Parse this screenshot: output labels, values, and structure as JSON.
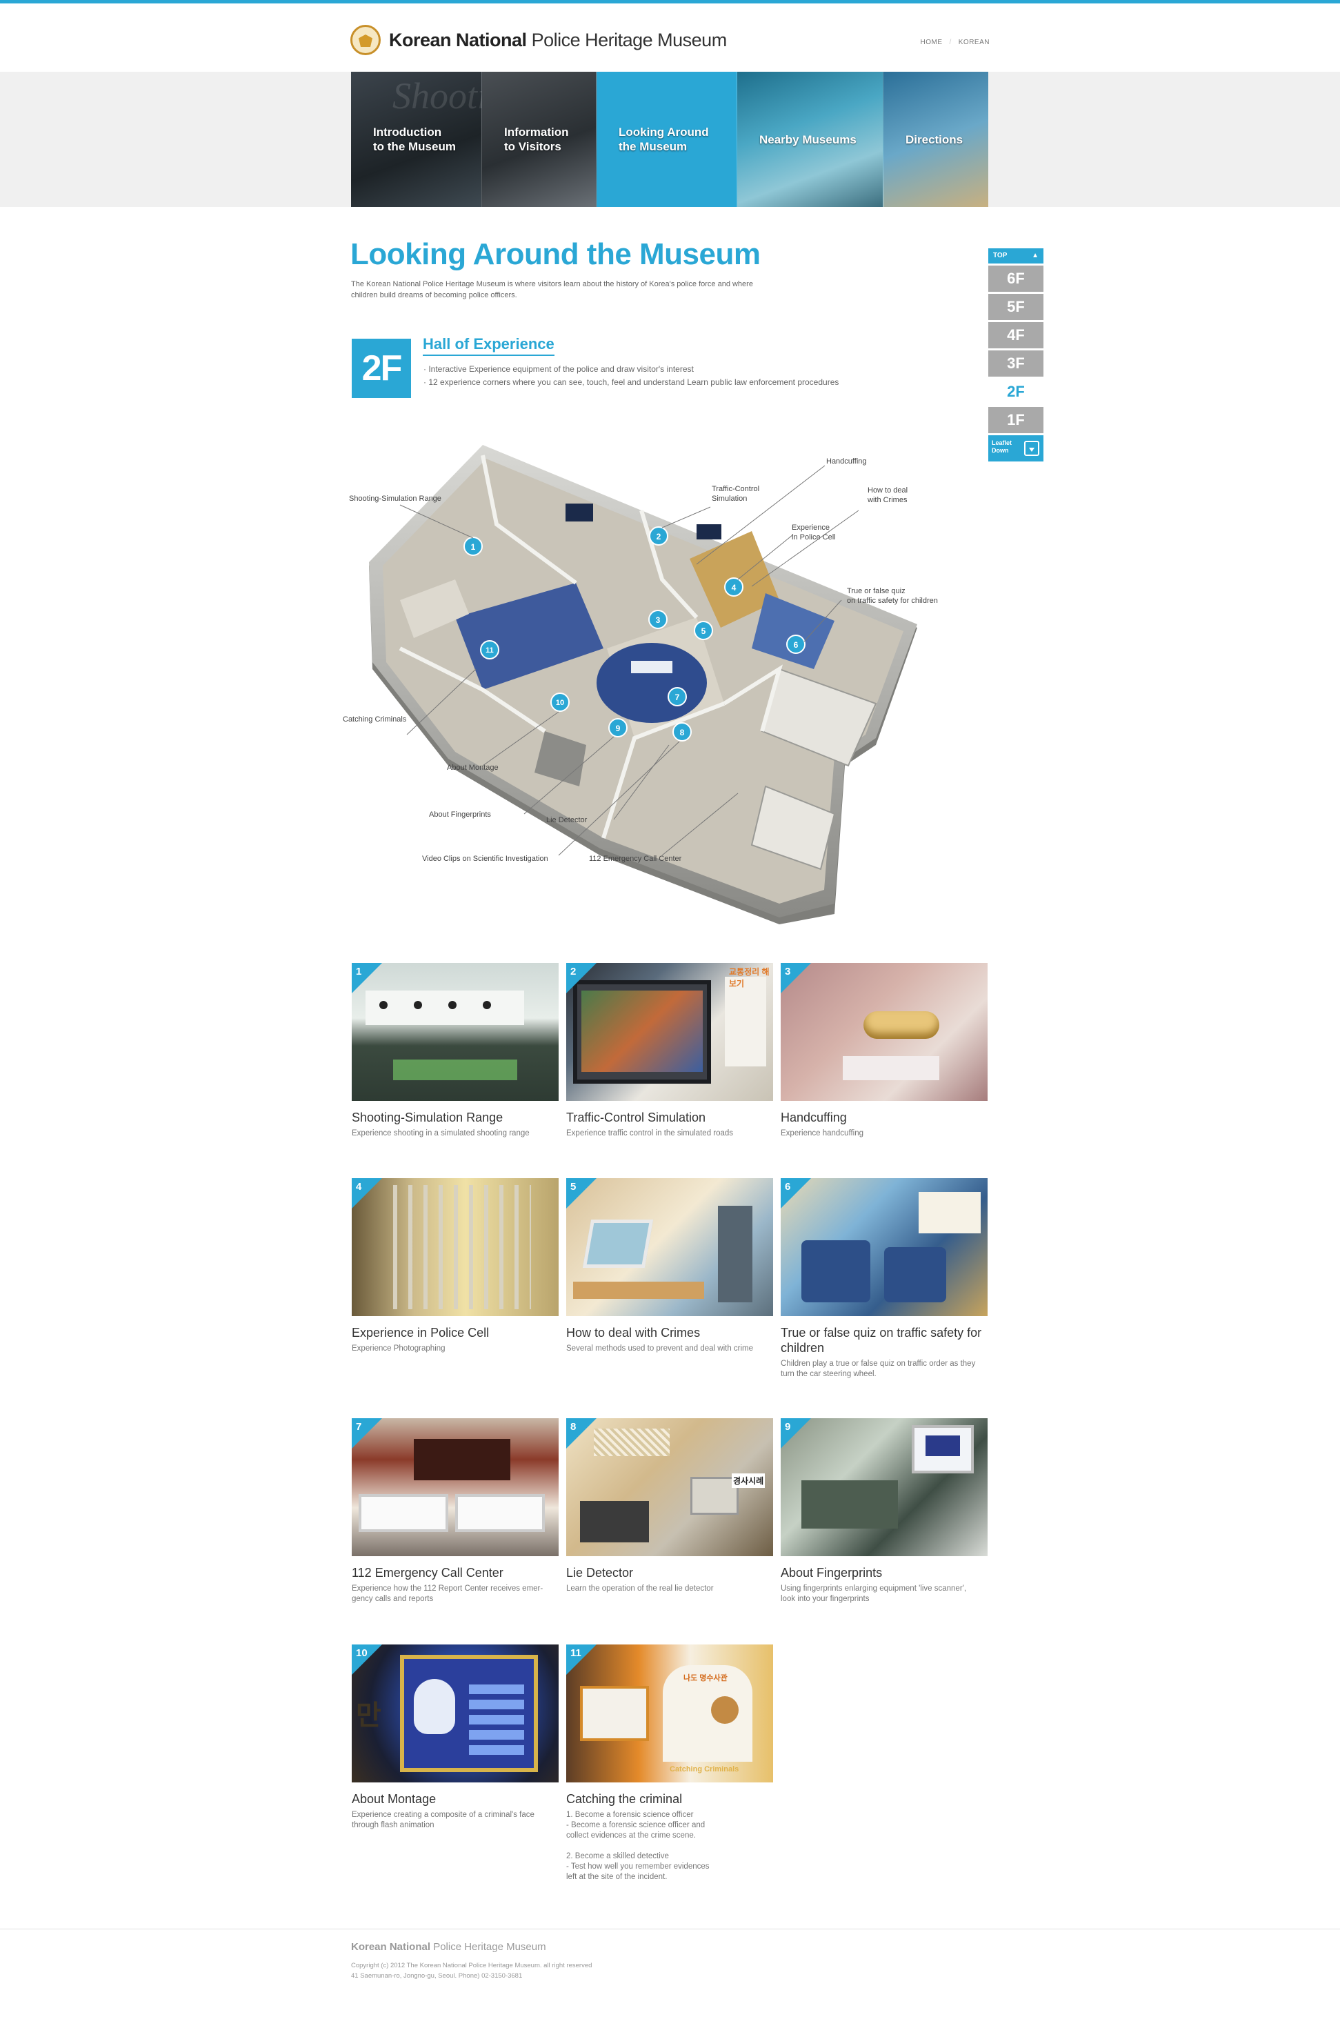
{
  "header": {
    "logo_bold": "Korean National",
    "logo_rest": "Police Heritage Museum",
    "util_links": [
      "HOME",
      "KOREAN"
    ]
  },
  "nav": {
    "items": [
      {
        "label": "Introduction\nto the Museum",
        "active": false
      },
      {
        "label": "Information\nto Visitors",
        "active": false
      },
      {
        "label": "Looking Around\nthe Museum",
        "active": true
      },
      {
        "label": "Nearby Museums",
        "active": false
      },
      {
        "label": "Directions",
        "active": false
      }
    ],
    "deco_text": "Shooting"
  },
  "page": {
    "title": "Looking Around the Museum",
    "description": "The Korean National Police Heritage Museum is where visitors learn about the history of Korea's police force and where children build dreams of becoming police officers."
  },
  "floor_nav": {
    "top_label": "TOP",
    "floors": [
      "6F",
      "5F",
      "4F",
      "3F",
      "2F",
      "1F"
    ],
    "current": "2F",
    "leaflet_label": "Leaflet\nDown"
  },
  "section": {
    "floor": "2F",
    "title": "Hall of Experience",
    "bullets": [
      "Interactive Experience equipment of the police and draw visitor's interest",
      "12 experience corners where you can see, touch, feel and understand Learn public law enforcement procedures"
    ]
  },
  "map_callouts": {
    "shooting": "Shooting-Simulation Range",
    "traffic": "Traffic-Control\nSimulation",
    "handcuffing": "Handcuffing",
    "crimes": "How to deal\nwith Crimes",
    "cell": "Experience\nin Police Cell",
    "quiz": "True or false quiz\non traffic safety for children",
    "catching": "Catching Criminals",
    "montage": "About Montage",
    "fingerprints": "About Fingerprints",
    "lie": "Lie Detector",
    "video": "Video Clips on Scientific Investigation",
    "call": "112 Emergency Call Center"
  },
  "map_markers": [
    "1",
    "2",
    "3",
    "4",
    "5",
    "6",
    "7",
    "8",
    "9",
    "10",
    "11"
  ],
  "cards": [
    {
      "num": "1",
      "title": "Shooting-Simulation Range",
      "desc": "Experience shooting in a simulated shooting range"
    },
    {
      "num": "2",
      "title": "Traffic-Control Simulation",
      "desc": "Experience traffic control in the simulated roads"
    },
    {
      "num": "3",
      "title": "Handcuffing",
      "desc": "Experience handcuffing"
    },
    {
      "num": "4",
      "title": "Experience in Police Cell",
      "desc": "Experience Photographing"
    },
    {
      "num": "5",
      "title": "How to deal with Crimes",
      "desc": "Several methods used to prevent and deal with crime"
    },
    {
      "num": "6",
      "title": "True or false quiz on traffic safety for children",
      "desc": "Children play a true or false quiz on traffic order as they turn the car steering wheel."
    },
    {
      "num": "7",
      "title": "112 Emergency Call Center",
      "desc": "Experience how the 112 Report Center receives emer-\ngency calls and reports"
    },
    {
      "num": "8",
      "title": "Lie Detector",
      "desc": "Learn the operation of the real lie detector"
    },
    {
      "num": "9",
      "title": "About Fingerprints",
      "desc": "Using fingerprints enlarging equipment 'live scanner',\nlook into your fingerprints"
    },
    {
      "num": "10",
      "title": "About Montage",
      "desc": "Experience creating a composite of a criminal's face\nthrough flash animation"
    },
    {
      "num": "11",
      "title": "Catching the criminal",
      "desc": "1. Become a forensic science officer\n - Become a forensic science officer and\n   collect evidences at the crime scene.\n\n2. Become a skilled detective\n - Test how well you remember evidences\n   left at the site of the incident."
    }
  ],
  "photo_texts": {
    "p2_sign": "교통정리 해보기",
    "p8_sign": "경사시례",
    "p10_side": "만",
    "p11_sign": "나도 명수사관",
    "p11_floor": "Catching Criminals"
  },
  "footer": {
    "logo_bold": "Korean National",
    "logo_rest": "Police Heritage Museum",
    "copy": "Copyright (c) 2012 The Korean National Police Heritage Museum. all right reserved\n41 Saemunan-ro, Jongno-gu, Seoul. Phone) 02-3150-3681"
  },
  "colors": {
    "accent": "#2aa7d5",
    "floor_inactive": "#a9a9a9"
  }
}
